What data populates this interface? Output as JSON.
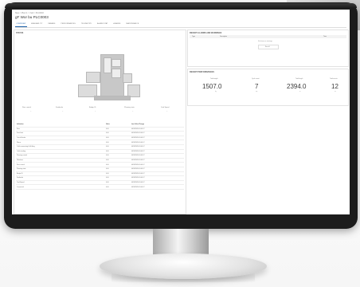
{
  "breadcrumb": "Sites > Plant 1 > Yard > PLC0003",
  "title": "gF Wor bu PLC0003",
  "tabs": [
    "OVERVIEW",
    "AVAILABILITY",
    "PARAMS",
    "PERFORMANCES",
    "TELEMETRY",
    "ALARM STAT",
    "ALARMS",
    "MAINTENANCE"
  ],
  "status_panel": {
    "title": "STATUS",
    "cards": [
      {
        "label": "Rear control",
        "value": "--"
      },
      {
        "label": "Footbrake",
        "value": "--"
      },
      {
        "label": "Bridge ID",
        "value": "--"
      },
      {
        "label": "Planning state",
        "value": "--"
      },
      {
        "label": "Yard Speed",
        "value": "--"
      }
    ]
  },
  "status_table": {
    "headers": [
      "Indication",
      "Value",
      "Last Value Change"
    ],
    "rows": [
      [
        "Rear",
        "0.00",
        "06/18/2020 09:40:17"
      ],
      [
        "Front limit",
        "0.00",
        "06/18/2020 09:40:17"
      ],
      [
        "Over-tilt brake",
        "0.00",
        "06/18/2020 09:40:17"
      ],
      [
        "Warns",
        "0.00",
        "06/18/2020 09:40:17"
      ],
      [
        "Cable connecting & tilt tilting",
        "0.00",
        "06/18/2020 09:40:17"
      ],
      [
        "Cable tending",
        "0.00",
        "06/18/2020 09:40:17"
      ],
      [
        "Planning control",
        "0.00",
        "06/18/2020 09:40:17"
      ],
      [
        "Vibrations",
        "0.00",
        "06/18/2020 09:40:17"
      ],
      [
        "Rear control",
        "0.00",
        "06/18/2020 09:40:17"
      ],
      [
        "Planning state",
        "0.00",
        "06/18/2020 09:40:17"
      ],
      [
        "Bridge ID",
        "0.00",
        "06/18/2020 09:40:17"
      ],
      [
        "Footbrake",
        "0.00",
        "06/18/2020 09:40:17"
      ],
      [
        "Yard Speed",
        "0.00",
        "06/18/2020 09:40:17"
      ],
      [
        "Connected",
        "0.00",
        "06/18/2020 09:40:17"
      ]
    ]
  },
  "alarms_panel": {
    "title": "RECENT ALARMS AND WARNINGS",
    "headers": [
      "Type",
      "Description",
      "Time"
    ],
    "empty_text": "No alarms or warnings",
    "link": "See all"
  },
  "perf_panel": {
    "title": "RECENT PERFORMANCES",
    "items": [
      {
        "label": "Total weight",
        "value": "1507.0",
        "unit": "kg"
      },
      {
        "label": "Cycle count",
        "value": "7",
        "unit": "cyc"
      },
      {
        "label": "Total length",
        "value": "2394.0",
        "unit": "m"
      },
      {
        "label": "Total events",
        "value": "12",
        "unit": "ev"
      }
    ]
  }
}
